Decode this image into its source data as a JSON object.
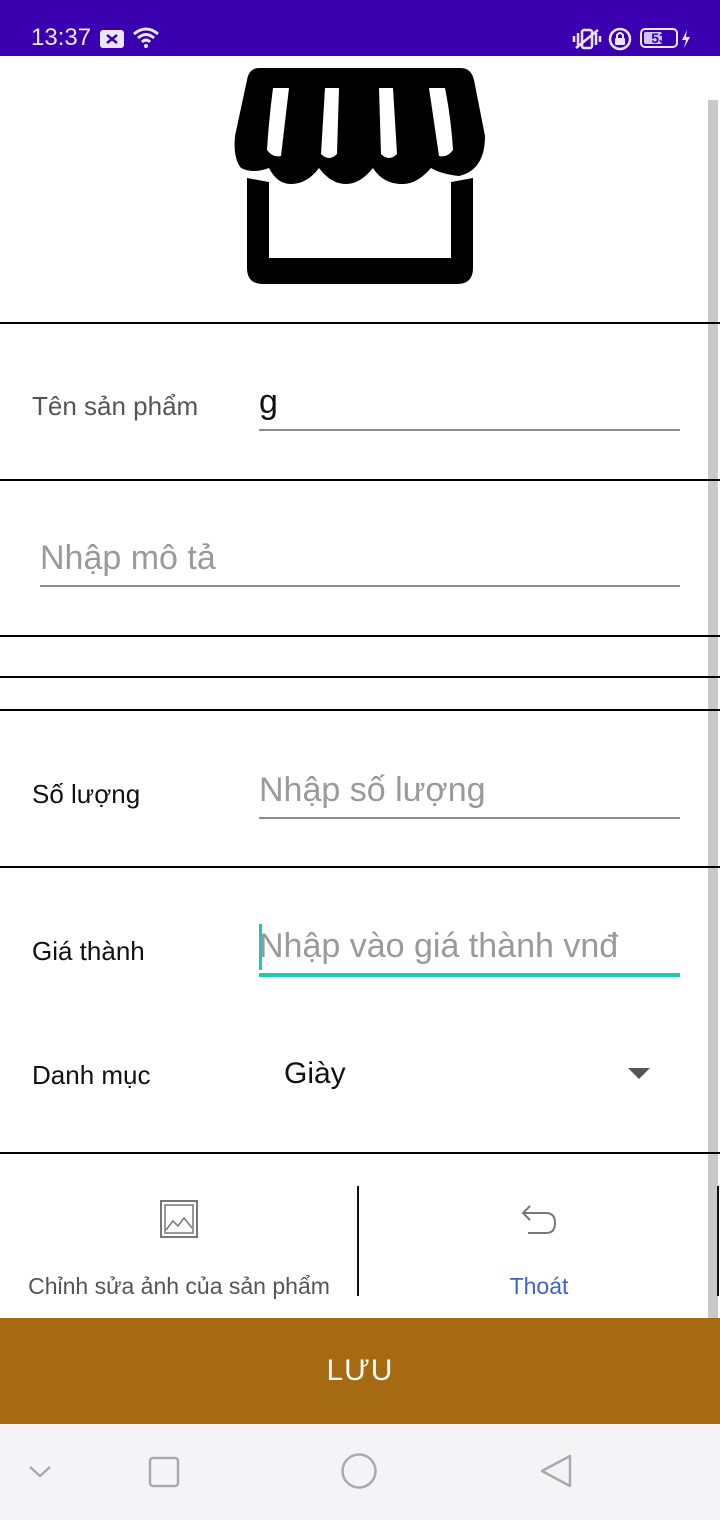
{
  "status_bar": {
    "time": "13:37",
    "battery_level": "53",
    "background": "#3a00b0"
  },
  "form": {
    "product_name_label": "Tên sản phẩm",
    "product_name_value": "g",
    "description_placeholder": "Nhập mô tả",
    "quantity_label": "Số lượng",
    "quantity_placeholder": "Nhập số lượng",
    "price_label": "Giá thành",
    "price_placeholder": "Nhập vào giá thành vnđ",
    "category_label": "Danh mục",
    "category_value": "Giày"
  },
  "actions": {
    "edit_image_label": "Chỉnh sửa ảnh của sản phẩm",
    "exit_label": "Thoát"
  },
  "save_button": {
    "label": "LƯU",
    "background": "#a56a12"
  },
  "icons": {
    "header": "store-icon",
    "edit_image": "image-icon",
    "exit": "undo-icon"
  },
  "colors": {
    "accent_teal": "#1ec8b4",
    "link_blue": "#3f63c6"
  }
}
